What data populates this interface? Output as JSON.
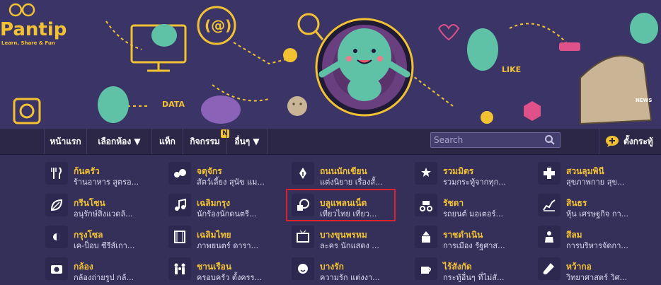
{
  "brand": {
    "name": "Pantip",
    "tagline": "Learn, Share & Fun"
  },
  "banner": {
    "at_sign": "(@)",
    "data_label": "DATA",
    "like_label": "LIKE",
    "news_label": "NEWS"
  },
  "nav": {
    "items": [
      {
        "label": "หน้าแรก"
      },
      {
        "label": "เลือกห้อง ▼"
      },
      {
        "label": "แท็ก"
      },
      {
        "label": "กิจกรรม",
        "badge": "N"
      },
      {
        "label": "อื่นๆ ▼"
      }
    ],
    "search_placeholder": "Search",
    "new_topic_label": "ตั้งกระทู้"
  },
  "rooms": [
    {
      "title": "ก้นครัว",
      "desc": "ร้านอาหาร สูตรอ...",
      "icon": "fork-knife-icon"
    },
    {
      "title": "จตุจักร",
      "desc": "สัตว์เลี้ยง สุนัข แม...",
      "icon": "pets-icon"
    },
    {
      "title": "ถนนนักเขียน",
      "desc": "แต่งนิยาย เรื่องสั้...",
      "icon": "pen-icon"
    },
    {
      "title": "รวมมิตร",
      "desc": "รวมกระทู้จากทุก...",
      "icon": "stars-icon"
    },
    {
      "title": "สวนลุมพินี",
      "desc": "สุขภาพกาย สุข...",
      "icon": "medical-cross-icon"
    },
    {
      "title": "กรีนโซน",
      "desc": "อนุรักษ์สิ่งแวดล้...",
      "icon": "leaf-icon"
    },
    {
      "title": "เฉลิมกรุง",
      "desc": "นักร้องนักดนตรี...",
      "icon": "music-note-icon"
    },
    {
      "title": "บลูแพลนเน็ต",
      "desc": "เที่ยวไทย เที่ยว...",
      "icon": "globe-luggage-icon"
    },
    {
      "title": "รัชดา",
      "desc": "รถยนต์ มอเตอร์...",
      "icon": "vehicles-icon"
    },
    {
      "title": "สินธร",
      "desc": "หุ้น เศรษฐกิจ กา...",
      "icon": "stock-chart-icon"
    },
    {
      "title": "กรุงโซล",
      "desc": "เค-ป็อบ ซีรีส์เกา...",
      "icon": "korea-flag-icon"
    },
    {
      "title": "เฉลิมไทย",
      "desc": "ภาพยนตร์ ดารา...",
      "icon": "film-strip-icon"
    },
    {
      "title": "บางขุนพรหม",
      "desc": "ละคร นักแสดง ...",
      "icon": "tv-icon"
    },
    {
      "title": "ราชดำเนิน",
      "desc": "การเมือง รัฐศาส...",
      "icon": "monument-icon"
    },
    {
      "title": "สีลม",
      "desc": "การบริหารจัดกา...",
      "icon": "business-person-icon"
    },
    {
      "title": "กล้อง",
      "desc": "กล้องถ่ายรูป กล้...",
      "icon": "camera-icon"
    },
    {
      "title": "ชานเรือน",
      "desc": "ครอบครัว ตั้งครร...",
      "icon": "family-icon"
    },
    {
      "title": "บางรัก",
      "desc": "ความรัก แต่งงา...",
      "icon": "love-faces-icon"
    },
    {
      "title": "ไร้สังกัด",
      "desc": "กระทู้อื่นๆ ที่ไม่สั...",
      "icon": "coffee-cup-icon"
    },
    {
      "title": "หว้ากอ",
      "desc": "วิทยาศาสตร์ วิศ...",
      "icon": "test-tube-icon"
    }
  ],
  "colors": {
    "background": "#35305a",
    "banner": "#3a3467",
    "accent": "#f3c233",
    "mascot": "#5fc1a6",
    "highlight": "#d8252b",
    "navbar": "#2c2747"
  }
}
